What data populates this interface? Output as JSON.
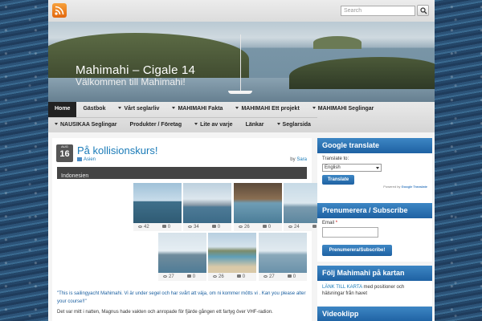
{
  "colors": {
    "accent": "#1f62a3",
    "link": "#1a7bb8",
    "nav_active": "#222222"
  },
  "topbar": {
    "rss_icon": "rss-icon",
    "search_placeholder": "Search",
    "search_icon": "search-icon"
  },
  "header": {
    "site_title": "Mahimahi – Cigale 14",
    "tagline": "Välkommen till Mahimahi!"
  },
  "nav": {
    "row1": [
      {
        "label": "Home",
        "active": true,
        "dropdown": false
      },
      {
        "label": "Gästbok",
        "dropdown": false
      },
      {
        "label": "Vårt seglarliv",
        "dropdown": true
      },
      {
        "label": "MAHIMAHI Fakta",
        "dropdown": true
      },
      {
        "label": "MAHIMAHI Ett projekt",
        "dropdown": true
      },
      {
        "label": "MAHIMAHI Seglingar",
        "dropdown": true
      }
    ],
    "row2": [
      {
        "label": "NAUSIKAA Seglingar",
        "dropdown": true
      },
      {
        "label": "Produkter / Företag",
        "dropdown": false
      },
      {
        "label": "Lite av varje",
        "dropdown": true
      },
      {
        "label": "Länkar",
        "dropdown": false
      },
      {
        "label": "Seglarsida",
        "dropdown": true
      }
    ]
  },
  "post": {
    "date_month": "AUG",
    "date_day": "16",
    "title": "På kollisionskurs!",
    "category": "Asien",
    "author_prefix": "by",
    "author": "Sara",
    "tag_bar": "Indonesien",
    "thumbnails": [
      {
        "views": "42",
        "comments": "0"
      },
      {
        "views": "34",
        "comments": "0"
      },
      {
        "views": "26",
        "comments": "0"
      },
      {
        "views": "24",
        "comments": "0"
      },
      {
        "views": "27",
        "comments": "0"
      },
      {
        "views": "26",
        "comments": "0"
      },
      {
        "views": "27",
        "comments": "0"
      }
    ],
    "quote": "\"This is sailingyacht Mahimahi. Vi är under segel och har svårt att väja, om ni kommer mötts vi . Kan you please alter your course!!\"",
    "paragraph": "Det var mitt i natten, Magnus hade vakten och anropade för fjärde gången ett fartyg över VHF-radion."
  },
  "sidebar": {
    "google_translate": {
      "title": "Google translate",
      "label": "Translate to:",
      "selected": "English",
      "button": "Translate",
      "powered_by": "Powered by",
      "powered_brand": "Google Translate"
    },
    "subscribe": {
      "title": "Prenumerera / Subscribe",
      "email_label": "Email",
      "required_mark": "*",
      "button": "Prenumerera/Subscribe!"
    },
    "map": {
      "title": "Följ Mahimahi på kartan",
      "link": "LÄNK TILL KARTA",
      "text": " med positioner och hälsningar från havet"
    },
    "video": {
      "title": "Videoklipp"
    }
  }
}
